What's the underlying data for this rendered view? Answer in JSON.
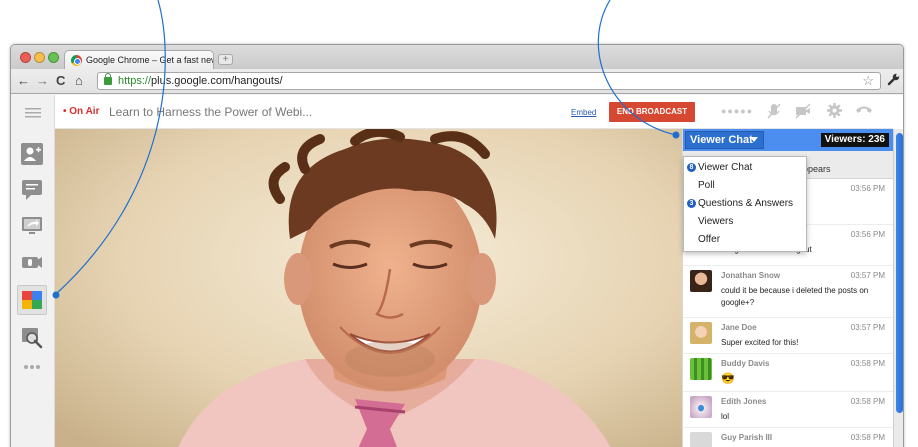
{
  "browser": {
    "tab_title": "Google Chrome – Get a fast new browser",
    "url_scheme": "https://",
    "url_rest": "plus.google.com/hangouts/"
  },
  "hangout": {
    "on_air": "On Air",
    "title": "Learn to Harness the Power of Webi...",
    "embed_label": "Embed",
    "end_broadcast_label": "END BROADCAST"
  },
  "chat": {
    "selector_label": "Viewer Chat",
    "viewers_label": "Viewers: 236",
    "partial_text": "opears",
    "menu": [
      {
        "label": "Viewer Chat",
        "count": "8"
      },
      {
        "label": "Poll",
        "count": ""
      },
      {
        "label": "Questions & Answers",
        "count": "3"
      },
      {
        "label": "Viewers",
        "count": ""
      },
      {
        "label": "Offer",
        "count": ""
      }
    ],
    "messages": [
      {
        "name": "",
        "time": "03:56 PM",
        "text": ""
      },
      {
        "name": "",
        "time": "03:56 PM",
        "text": "bring me into the hangout"
      },
      {
        "name": "Jonathan Snow",
        "time": "03:57 PM",
        "text": "could it be because i deleted the posts on google+?"
      },
      {
        "name": "Jane Doe",
        "time": "03:57 PM",
        "text": "Super excited for this!"
      },
      {
        "name": "Buddy Davis",
        "time": "03:58 PM",
        "text": "😎"
      },
      {
        "name": "Edith Jones",
        "time": "03:58 PM",
        "text": "lol"
      },
      {
        "name": "Guy Parish III",
        "time": "03:58 PM",
        "text": ""
      }
    ]
  },
  "colors": {
    "accent_blue": "#4c8ef0",
    "on_air_red": "#d9302d",
    "end_button": "#d74832",
    "callout_line": "#1f6fd0"
  },
  "icons": {
    "sidebar": [
      "add-person-icon",
      "chat-icon",
      "screenshare-icon",
      "camera-off-icon",
      "google-effects-icon",
      "zoom-photo-icon",
      "more-icon"
    ],
    "controls": [
      "mic-mute-icon",
      "camera-mute-icon",
      "settings-icon",
      "hang-up-icon"
    ]
  }
}
